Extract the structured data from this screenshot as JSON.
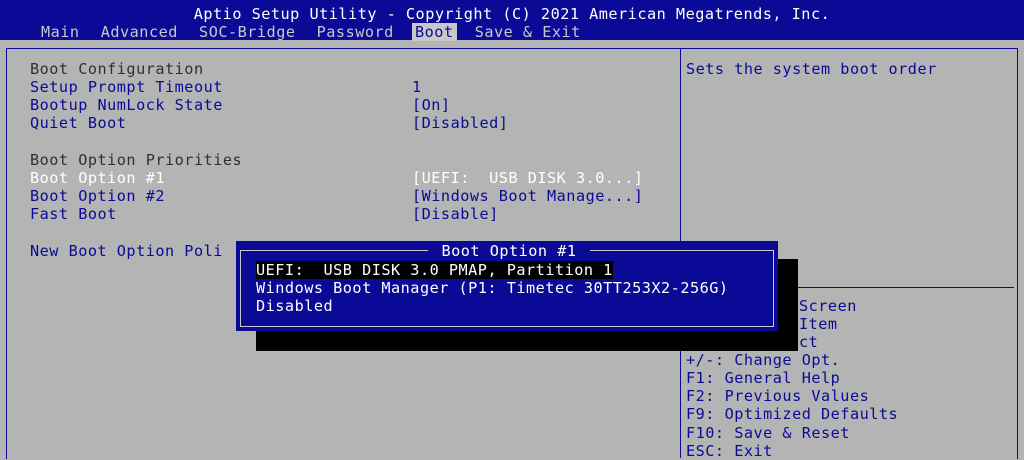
{
  "header": {
    "title": "Aptio Setup Utility - Copyright (C) 2021 American Megatrends, Inc.",
    "tabs": [
      "Main",
      "Advanced",
      "SOC-Bridge",
      "Password",
      "Boot",
      "Save & Exit"
    ],
    "active_tab": "Boot"
  },
  "settings": {
    "boot_configuration": "Boot Configuration",
    "setup_prompt_timeout": {
      "label": "Setup Prompt Timeout",
      "value": "1"
    },
    "bootup_numlock_state": {
      "label": "Bootup NumLock State",
      "value": "[On]"
    },
    "quiet_boot": {
      "label": "Quiet Boot",
      "value": "[Disabled]"
    },
    "boot_option_priorities": "Boot Option Priorities",
    "boot_option_1": {
      "label": "Boot Option #1",
      "value": "[UEFI:  USB DISK 3.0...]"
    },
    "boot_option_2": {
      "label": "Boot Option #2",
      "value": "[Windows Boot Manage...]"
    },
    "fast_boot": {
      "label": "Fast Boot",
      "value": "[Disable]"
    },
    "new_boot_option_policy": {
      "label": "New Boot Option Poli"
    }
  },
  "help": {
    "description": "Sets the system boot order",
    "keys": [
      "Screen",
      "Item",
      "ct",
      "+/-: Change Opt.",
      "F1: General Help",
      "F2: Previous Values",
      "F9: Optimized Defaults",
      "F10: Save & Reset",
      "ESC: Exit"
    ]
  },
  "popup": {
    "title": "Boot Option #1",
    "options": [
      "UEFI:  USB DISK 3.0 PMAP, Partition 1",
      "Windows Boot Manager (P1: Timetec 30TT253X2-256G)",
      "Disabled"
    ],
    "highlighted_option": "UEFI:  USB DISK 3.0 PMAP, Partition 1"
  },
  "colors": {
    "background": "#b4b4b4",
    "bios_blue": "#0a0a96",
    "text_white": "#ffffff",
    "highlight_black": "#000000"
  }
}
